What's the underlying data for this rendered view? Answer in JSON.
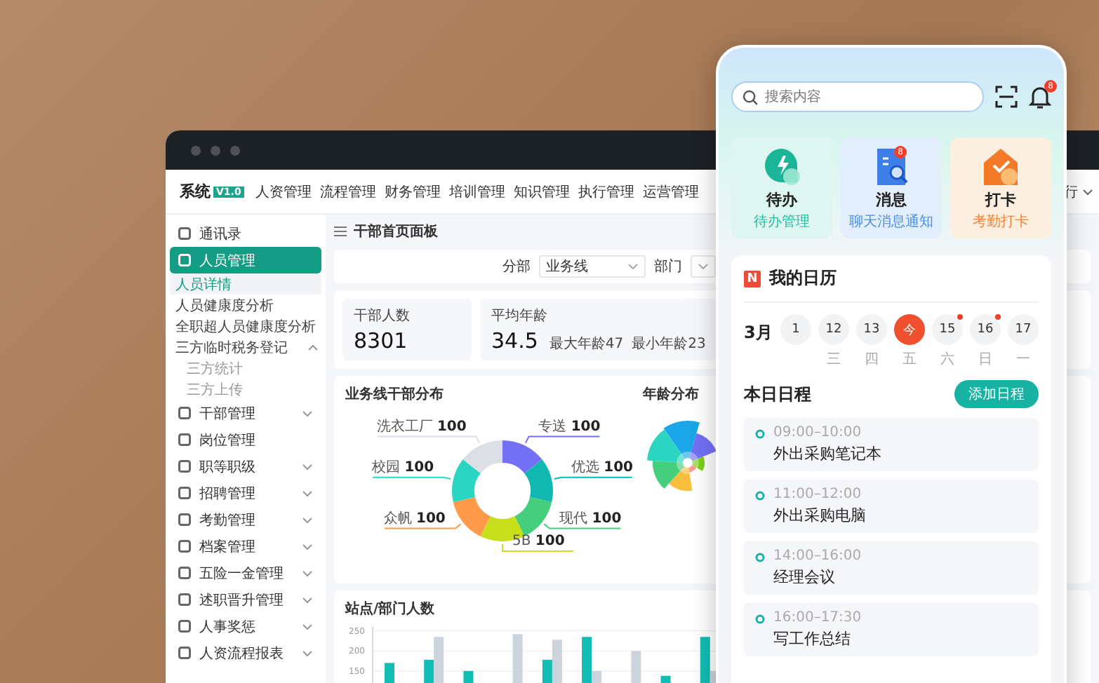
{
  "desktop": {
    "logo": {
      "title": "系统",
      "version": "V1.0"
    },
    "nav": [
      {
        "label": "人资管理"
      },
      {
        "label": "流程管理"
      },
      {
        "label": "财务管理"
      },
      {
        "label": "培训管理"
      },
      {
        "label": "知识管理"
      },
      {
        "label": "执行管理"
      },
      {
        "label": "运营管理"
      }
    ],
    "nav_right": {
      "label": "行"
    },
    "sidebar": {
      "items": [
        {
          "label": "通讯录",
          "selected": false,
          "expandable": false
        },
        {
          "label": "人员管理",
          "selected": true,
          "expandable": false,
          "expanded": true,
          "children": [
            {
              "label": "人员详情",
              "selected": true,
              "expandable": false
            },
            {
              "label": "人员健康度分析",
              "selected": false,
              "expandable": false
            },
            {
              "label": "全职超人员健康度分析",
              "selected": false,
              "expandable": false
            },
            {
              "label": "三方临时税务登记",
              "selected": false,
              "expandable": true,
              "expanded": true,
              "children": [
                {
                  "label": "三方统计",
                  "selected": false
                },
                {
                  "label": "三方上传",
                  "selected": false
                }
              ]
            }
          ]
        },
        {
          "label": "干部管理",
          "selected": false,
          "expandable": true,
          "expanded": false
        },
        {
          "label": "岗位管理",
          "selected": false,
          "expandable": false
        },
        {
          "label": "职等职级",
          "selected": false,
          "expandable": true,
          "expanded": false
        },
        {
          "label": "招聘管理",
          "selected": false,
          "expandable": true,
          "expanded": false
        },
        {
          "label": "考勤管理",
          "selected": false,
          "expandable": true,
          "expanded": false
        },
        {
          "label": "档案管理",
          "selected": false,
          "expandable": true,
          "expanded": false
        },
        {
          "label": "五险一金管理",
          "selected": false,
          "expandable": true,
          "expanded": false
        },
        {
          "label": "述职晋升管理",
          "selected": false,
          "expandable": true,
          "expanded": false
        },
        {
          "label": "人事奖惩",
          "selected": false,
          "expandable": true,
          "expanded": false
        },
        {
          "label": "人资流程报表",
          "selected": false,
          "expandable": true,
          "expanded": false
        }
      ]
    },
    "page_title": "干部首页面板",
    "filters": [
      {
        "label": "分部",
        "value": "业务线"
      },
      {
        "label": "部门"
      }
    ],
    "stats": [
      {
        "label": "干部人数",
        "value": "8301"
      },
      {
        "label": "平均年龄",
        "value": "34.5",
        "notes": [
          "最大年龄47",
          "最小年龄23"
        ]
      }
    ],
    "donut": {
      "chart_data": {
        "type": "donut",
        "title": "业务线干部分布",
        "categories": [
          "专送",
          "优选",
          "现代",
          "5B",
          "众帆",
          "校园",
          "洗衣工厂"
        ],
        "values": [
          100,
          100,
          100,
          100,
          100,
          100,
          100
        ],
        "data_labels": true
      }
    },
    "rose": {
      "title": "年龄分布"
    },
    "bars": {
      "chart_data": {
        "type": "bar",
        "title": "站点/部门人数",
        "ylim": [
          120,
          260
        ],
        "grid": true,
        "yticks": [
          150,
          200,
          250
        ],
        "series": [
          {
            "color": "#12bdb4",
            "values": [
              170,
              178,
              150,
              null,
              178,
              235,
              null,
              138,
              235
            ]
          },
          {
            "color": "#cdd3dd",
            "values": [
              null,
              235,
              null,
              242,
              228,
              150,
              200,
              null,
              150
            ]
          }
        ]
      }
    }
  },
  "phone": {
    "search": {
      "placeholder": "搜索内容"
    },
    "bell_badge": "8",
    "shortcuts": [
      {
        "kind": "todo",
        "title": "待办",
        "subtitle": "待办管理"
      },
      {
        "kind": "message",
        "title": "消息",
        "subtitle": "聊天消息通知",
        "badge": "8"
      },
      {
        "kind": "checkin",
        "title": "打卡",
        "subtitle": "考勤打卡"
      }
    ],
    "calendar": {
      "logo_letter": "N",
      "title": "我的日历",
      "month": "3月",
      "days": [
        {
          "day": "1",
          "selected": false,
          "has_event": false
        },
        {
          "day": "12",
          "weekday": "三",
          "selected": false,
          "has_event": false
        },
        {
          "day": "13",
          "weekday": "四",
          "selected": false,
          "has_event": false
        },
        {
          "day": "今",
          "weekday": "五",
          "selected": true,
          "has_event": false
        },
        {
          "day": "15",
          "weekday": "六",
          "selected": false,
          "has_event": true
        },
        {
          "day": "16",
          "weekday": "日",
          "selected": false,
          "has_event": true
        },
        {
          "day": "17",
          "weekday": "一",
          "selected": false,
          "has_event": false
        }
      ]
    },
    "schedule": {
      "title": "本日日程",
      "add_button": "添加日程",
      "events": [
        {
          "time": "09:00–10:00",
          "title": "外出采购笔记本"
        },
        {
          "time": "11:00–12:00",
          "title": "外出采购电脑"
        },
        {
          "time": "14:00–16:00",
          "title": "经理会议"
        },
        {
          "time": "16:00–17:30",
          "title": "写工作总结"
        }
      ]
    }
  }
}
